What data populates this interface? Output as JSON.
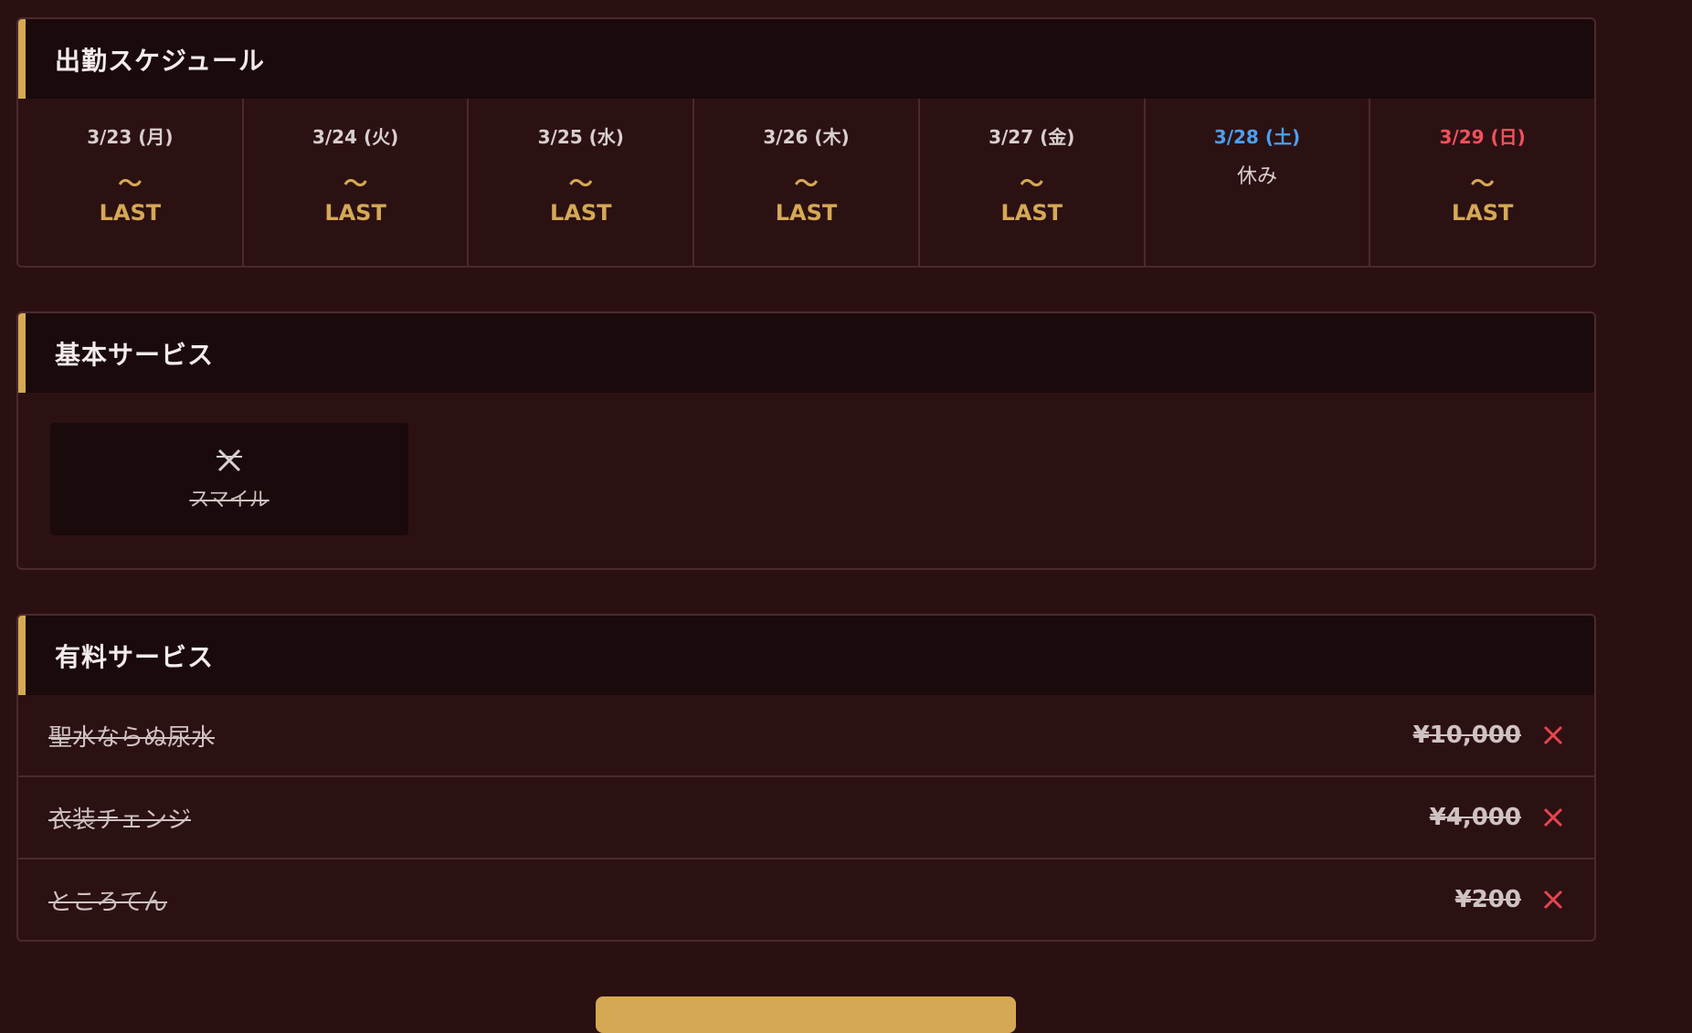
{
  "colors": {
    "background": "#2b1012",
    "accent_gold": "#d5a954",
    "saturday_blue": "#4aa0f0",
    "sunday_red": "#f0525c",
    "unavailable_red": "#e5454f"
  },
  "schedule": {
    "title": "出勤スケジュール",
    "days": [
      {
        "date": "3/23 (月)",
        "tilde": "〜",
        "end": "LAST"
      },
      {
        "date": "3/24 (火)",
        "tilde": "〜",
        "end": "LAST"
      },
      {
        "date": "3/25 (水)",
        "tilde": "〜",
        "end": "LAST"
      },
      {
        "date": "3/26 (木)",
        "tilde": "〜",
        "end": "LAST"
      },
      {
        "date": "3/27 (金)",
        "tilde": "〜",
        "end": "LAST"
      },
      {
        "date": "3/28 (土)",
        "off": "休み"
      },
      {
        "date": "3/29 (日)",
        "tilde": "〜",
        "end": "LAST"
      }
    ]
  },
  "basic": {
    "title": "基本サービス",
    "items": [
      {
        "label": "スマイル",
        "icon": "x-icon"
      }
    ]
  },
  "paid": {
    "title": "有料サービス",
    "items": [
      {
        "name": "聖水ならぬ尿水",
        "price": "¥10,000",
        "icon": "close-icon"
      },
      {
        "name": "衣装チェンジ",
        "price": "¥4,000",
        "icon": "close-icon"
      },
      {
        "name": "ところてん",
        "price": "¥200",
        "icon": "close-icon"
      }
    ]
  }
}
